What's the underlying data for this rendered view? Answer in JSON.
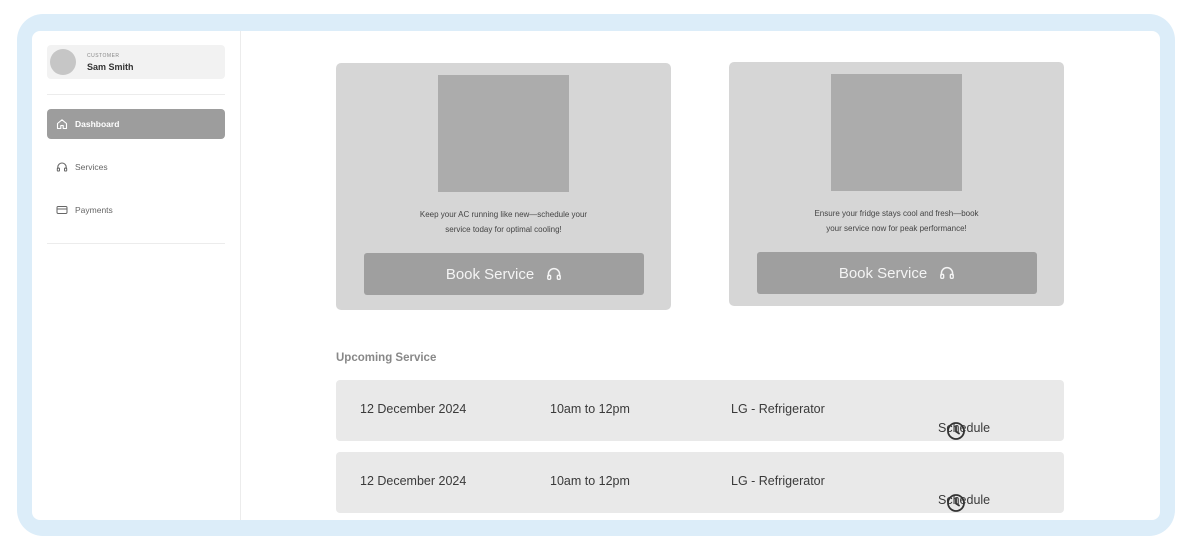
{
  "sidebar": {
    "profile": {
      "role": "CUSTOMER",
      "name": "Sam Smith"
    },
    "items": [
      {
        "label": "Dashboard",
        "icon": "home-icon",
        "active": true
      },
      {
        "label": "Services",
        "icon": "headphones-icon",
        "active": false
      },
      {
        "label": "Payments",
        "icon": "card-icon",
        "active": false
      }
    ]
  },
  "cards": [
    {
      "text_line1": "Keep your AC running like new—schedule your",
      "text_line2": "service today for optimal cooling!",
      "button": "Book Service",
      "button_icon": "headphones-icon"
    },
    {
      "text_line1": "Ensure your fridge stays cool and fresh—book",
      "text_line2": "your service now for peak performance!",
      "button": "Book Service",
      "button_icon": "headphones-icon"
    }
  ],
  "upcoming": {
    "title": "Upcoming Service",
    "rows": [
      {
        "date": "12 December 2024",
        "time": "10am to 12pm",
        "product": "LG - Refrigerator",
        "action": "Schedule",
        "icon": "clock-icon"
      },
      {
        "date": "12 December 2024",
        "time": "10am to 12pm",
        "product": "LG - Refrigerator",
        "action": "Schedule",
        "icon": "clock-icon"
      }
    ]
  },
  "colors": {
    "frame": "#dcedf9",
    "active_nav": "#9d9d9d",
    "card": "#d6d6d6",
    "button": "#9f9f9f",
    "row": "#e9e9e9"
  }
}
